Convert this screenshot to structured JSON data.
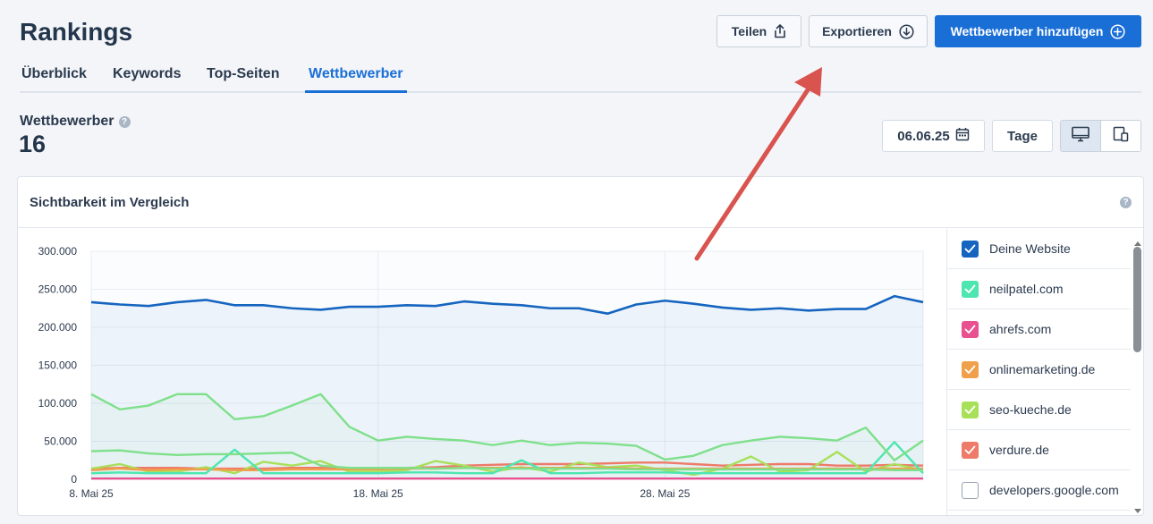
{
  "header": {
    "title": "Rankings",
    "share_label": "Teilen",
    "export_label": "Exportieren",
    "add_competitor_label": "Wettbewerber hinzufügen"
  },
  "tabs": [
    {
      "label": "Überblick",
      "active": false
    },
    {
      "label": "Keywords",
      "active": false
    },
    {
      "label": "Top-Seiten",
      "active": false
    },
    {
      "label": "Wettbewerber",
      "active": true
    }
  ],
  "summary": {
    "label": "Wettbewerber",
    "count": "16"
  },
  "controls": {
    "date": "06.06.25",
    "interval": "Tage",
    "device_selected": "desktop"
  },
  "card": {
    "title": "Sichtbarkeit im Vergleich"
  },
  "legend": [
    {
      "label": "Deine Website",
      "color": "#1565c0",
      "checked": true
    },
    {
      "label": "neilpatel.com",
      "color": "#4ee6b0",
      "checked": true
    },
    {
      "label": "ahrefs.com",
      "color": "#e8508f",
      "checked": true
    },
    {
      "label": "onlinemarketing.de",
      "color": "#f0a04b",
      "checked": true
    },
    {
      "label": "seo-kueche.de",
      "color": "#a8e05a",
      "checked": true
    },
    {
      "label": "verdure.de",
      "color": "#ee7a6a",
      "checked": true
    },
    {
      "label": "developers.google.com",
      "color": "#9aa4b2",
      "checked": false
    }
  ],
  "chart_data": {
    "type": "line",
    "title": "Sichtbarkeit im Vergleich",
    "x_tick_labels": [
      "8. Mai 25",
      "18. Mai 25",
      "28. Mai 25"
    ],
    "y_tick_labels": [
      "0",
      "50.000",
      "100.000",
      "150.000",
      "200.000",
      "250.000",
      "300.000"
    ],
    "ylim": [
      0,
      300000
    ],
    "grid": true,
    "x": [
      "8. Mai 25",
      "9. Mai 25",
      "10. Mai 25",
      "11. Mai 25",
      "12. Mai 25",
      "13. Mai 25",
      "14. Mai 25",
      "15. Mai 25",
      "16. Mai 25",
      "17. Mai 25",
      "18. Mai 25",
      "19. Mai 25",
      "20. Mai 25",
      "21. Mai 25",
      "22. Mai 25",
      "23. Mai 25",
      "24. Mai 25",
      "25. Mai 25",
      "26. Mai 25",
      "27. Mai 25",
      "28. Mai 25",
      "29. Mai 25",
      "30. Mai 25",
      "31. Mai 25",
      "1. Jun 25",
      "2. Jun 25",
      "3. Jun 25",
      "4. Jun 25",
      "5. Jun 25",
      "6. Jun 25"
    ],
    "series": [
      {
        "name": "Deine Website",
        "color": "#1565c0",
        "area": true,
        "values": [
          233000,
          230000,
          228000,
          233000,
          236000,
          229000,
          229000,
          225000,
          223000,
          227000,
          227000,
          229000,
          228000,
          234000,
          231000,
          229000,
          225000,
          225000,
          218000,
          230000,
          235000,
          231000,
          226000,
          223000,
          225000,
          222000,
          224000,
          224000,
          241000,
          233000
        ]
      },
      {
        "name": "",
        "color": "#7ee08a",
        "area": true,
        "values": [
          112000,
          92000,
          97000,
          112000,
          112000,
          79000,
          83000,
          97000,
          112000,
          69000,
          51000,
          56000,
          53000,
          51000,
          45000,
          51000,
          45000,
          48000,
          47000,
          44000,
          26000,
          31000,
          45000,
          51000,
          56000,
          54000,
          51000,
          68000,
          25000,
          51000
        ]
      },
      {
        "name": "",
        "color": "#7ee08a",
        "area": false,
        "values": [
          37000,
          38000,
          34000,
          32000,
          33000,
          33000,
          34000,
          35000,
          18000,
          15000,
          15000,
          15000,
          14000,
          15000,
          14000,
          14000,
          14000,
          14000,
          14000,
          13000,
          13000,
          13000,
          13000,
          13000,
          13000,
          13000,
          13000,
          13000,
          12000,
          12000
        ]
      },
      {
        "name": "neilpatel.com",
        "color": "#4ee6b0",
        "area": false,
        "values": [
          8000,
          9000,
          8000,
          8000,
          8000,
          39000,
          8000,
          8000,
          8000,
          8000,
          8000,
          9000,
          9000,
          8000,
          8000,
          25000,
          8000,
          8000,
          9000,
          9000,
          9000,
          8000,
          8000,
          8000,
          8000,
          8000,
          8000,
          8000,
          49000,
          8000
        ]
      },
      {
        "name": "ahrefs.com",
        "color": "#e8508f",
        "area": false,
        "values": [
          1000,
          1000,
          1000,
          1000,
          1000,
          1000,
          1000,
          1000,
          1000,
          1000,
          1000,
          1000,
          1000,
          1000,
          1000,
          1000,
          1000,
          1000,
          1000,
          1000,
          1000,
          1000,
          1000,
          1000,
          1000,
          1000,
          1000,
          1000,
          1000,
          1000
        ]
      },
      {
        "name": "onlinemarketing.de",
        "color": "#f0a04b",
        "area": false,
        "values": [
          12000,
          14000,
          12000,
          13000,
          13000,
          12000,
          12000,
          13000,
          13000,
          13000,
          13000,
          14000,
          14000,
          15000,
          15000,
          15000,
          15000,
          15000,
          15000,
          14000,
          14000,
          14000,
          14000,
          14000,
          14000,
          14000,
          14000,
          14000,
          14000,
          14000
        ]
      },
      {
        "name": "seo-kueche.de",
        "color": "#a8e05a",
        "area": false,
        "values": [
          14000,
          20000,
          10000,
          10000,
          16000,
          8000,
          23000,
          18000,
          24000,
          10000,
          10000,
          12000,
          24000,
          18000,
          10000,
          16000,
          10000,
          22000,
          16000,
          18000,
          12000,
          6000,
          14000,
          30000,
          10000,
          12000,
          36000,
          10000,
          20000,
          12000
        ]
      },
      {
        "name": "verdure.de",
        "color": "#ee7a6a",
        "area": false,
        "values": [
          14000,
          15000,
          15000,
          15000,
          14000,
          14000,
          14000,
          15000,
          15000,
          14000,
          13000,
          15000,
          16000,
          18000,
          19000,
          20000,
          20000,
          20000,
          21000,
          22000,
          22000,
          20000,
          18000,
          19000,
          20000,
          20000,
          18000,
          18000,
          19000,
          18000
        ]
      }
    ]
  }
}
